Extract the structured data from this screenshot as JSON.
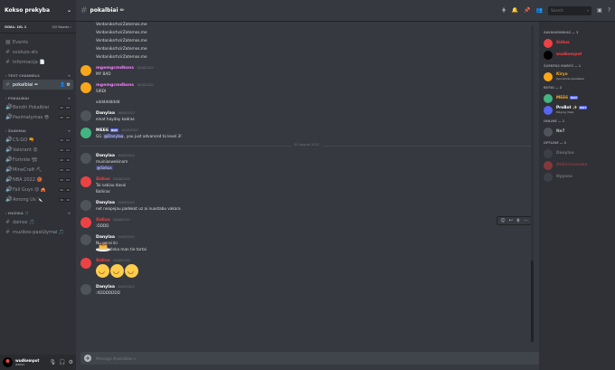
{
  "sidebar": {
    "server_name": "Kokso prekyba",
    "boost_goal": "GOAL: LVL 1",
    "boost_progress": "0/2 Boosts",
    "top_channels": [
      {
        "label": "Events"
      },
      {
        "label": "svoluzx-sts"
      },
      {
        "label": "informacija 📄"
      }
    ],
    "categories": [
      {
        "name": "TEXT CHANNELS",
        "channels": [
          {
            "label": "pokalbiai ✏",
            "active": true
          }
        ]
      },
      {
        "name": "POKALBIAI",
        "channels": [
          {
            "label": "Bendri Pokalbiai",
            "c1": "00",
            "c2": "80"
          },
          {
            "label": "Pasimatymas 😎",
            "c1": "00",
            "c2": "00"
          }
        ]
      },
      {
        "name": "ŽAIDIMAI",
        "channels": [
          {
            "label": "CS:GO 🔫",
            "c1": "00",
            "c2": "00"
          },
          {
            "label": "Valorant 😡",
            "c1": "00",
            "c2": "00"
          },
          {
            "label": "Fortnite 🏗",
            "c1": "00",
            "c2": "16"
          },
          {
            "label": "MineCraft ⛏",
            "c1": "00",
            "c2": "00"
          },
          {
            "label": "NBA 2022 🏀",
            "c1": "00",
            "c2": "00"
          },
          {
            "label": "Fall Guys 😜 🎪",
            "c1": "00",
            "c2": "16"
          },
          {
            "label": "Among Us 🔪",
            "c1": "00",
            "c2": "16"
          }
        ]
      },
      {
        "name": "MUZIKA 🎵",
        "channels": [
          {
            "label": "dainos 🎵"
          },
          {
            "label": "muzikos-pasiūlymai 🎵"
          }
        ]
      }
    ],
    "user": {
      "name": "wudkempot",
      "tag": "#6694"
    }
  },
  "topbar": {
    "channel": "pokalbiai ✏",
    "search_placeholder": "Search"
  },
  "chat": {
    "top_lines": [
      "VerdaniksrhcirZaternos.me",
      "VerdaniksrhcirZaternos.me",
      "VerdaniksrhcirZaternos.me",
      "VerdaniksrhcirZaternos.me",
      "VerdaniksrhcirZaternos.me"
    ],
    "messages": [
      {
        "author": "mgemgcmdkons",
        "date": "16/08/2022",
        "color": "#f47fff",
        "lines": [
          "MY BAD"
        ]
      },
      {
        "author": "mgemgcmdkons",
        "date": "16/08/2022",
        "color": "#f47fff",
        "lines": [
          "SIRDI"
        ]
      },
      {
        "author": "",
        "date": "",
        "color": "",
        "lines": [
          "xddddddddd"
        ]
      },
      {
        "author": "Danylaa",
        "date": "16/08/2022",
        "color": "#ffffff",
        "lines": [
          "einat hayday kadras"
        ]
      },
      {
        "author": "MEE6",
        "date": "16/08/2022",
        "color": "#ffffff",
        "bot": "BOT",
        "lines": [
          "GG @Danylaa, you just advanced to level 3!"
        ]
      },
      {
        "author": "Danylaa",
        "date": "20/08/2022",
        "color": "#ffffff",
        "lines": [
          "muiniaswekinom",
          "@Sidius"
        ]
      },
      {
        "author": "Sidius",
        "date": "20/08/2022",
        "color": "#ed4245",
        "lines": [
          "Tai sakiau davai",
          "Bahiras"
        ]
      },
      {
        "author": "Danylaa",
        "date": "20/08/2022",
        "color": "#ffffff",
        "lines": [
          "net neapejau padekot uz ai nuostabu vakara"
        ]
      },
      {
        "author": "Sidius",
        "date": "20/08/2022",
        "color": "#ed4245",
        "lines": [
          ":DDDD"
        ]
      },
      {
        "author": "Danylaa",
        "date": "20/08/2022",
        "color": "#ffffff",
        "lines": [
          "Nu gerai iki",
          "nebepatinka man tie tortai"
        ]
      },
      {
        "author": "Sidius",
        "date": "20/08/2022",
        "color": "#ed4245",
        "lines": [
          ""
        ]
      },
      {
        "author": "Danylaa",
        "date": "20/08/2022",
        "color": "#ffffff",
        "lines": [
          ":XDDDDDDD"
        ]
      }
    ],
    "date_divider": "20 August 2022",
    "input_placeholder": "Message #pokalbiai ✏"
  },
  "members": {
    "groups": [
      {
        "name": "SAVIKAMINKAS — 3",
        "items": [
          {
            "name": "Sidius",
            "color": "#ed4245",
            "status": ""
          },
          {
            "name": "wudkempot",
            "color": "#ed4245",
            "status": ""
          }
        ]
      },
      {
        "name": "ŠVENTAS MARYŠ — 1",
        "items": [
          {
            "name": "Kiryo",
            "color": "#faa61a",
            "status": "kyuriamas pikaibaiai"
          }
        ]
      },
      {
        "name": "BOTAI — 2",
        "items": [
          {
            "name": "MEE6",
            "color": "#faa61a",
            "status": "",
            "bot": "BOT"
          },
          {
            "name": "ProBot ✨",
            "color": "#ffffff",
            "status": "Playing /help",
            "bot": "BOT"
          }
        ]
      },
      {
        "name": "ONLINE — 1",
        "items": [
          {
            "name": "Ne7",
            "color": "#b9bbbe",
            "status": ""
          }
        ]
      },
      {
        "name": "OFFLINE — 3",
        "items": [
          {
            "name": "Danylaa",
            "color": "#b9bbbe",
            "status": "",
            "offline": true
          },
          {
            "name": "Stiklcinnmaka",
            "color": "#ed4245",
            "status": "",
            "offline": true
          },
          {
            "name": "Hyyonx",
            "color": "#b9bbbe",
            "status": "",
            "offline": true
          }
        ]
      }
    ]
  },
  "colors": {
    "accent": "#5865f2",
    "red": "#ed4245",
    "pink": "#f47fff"
  }
}
